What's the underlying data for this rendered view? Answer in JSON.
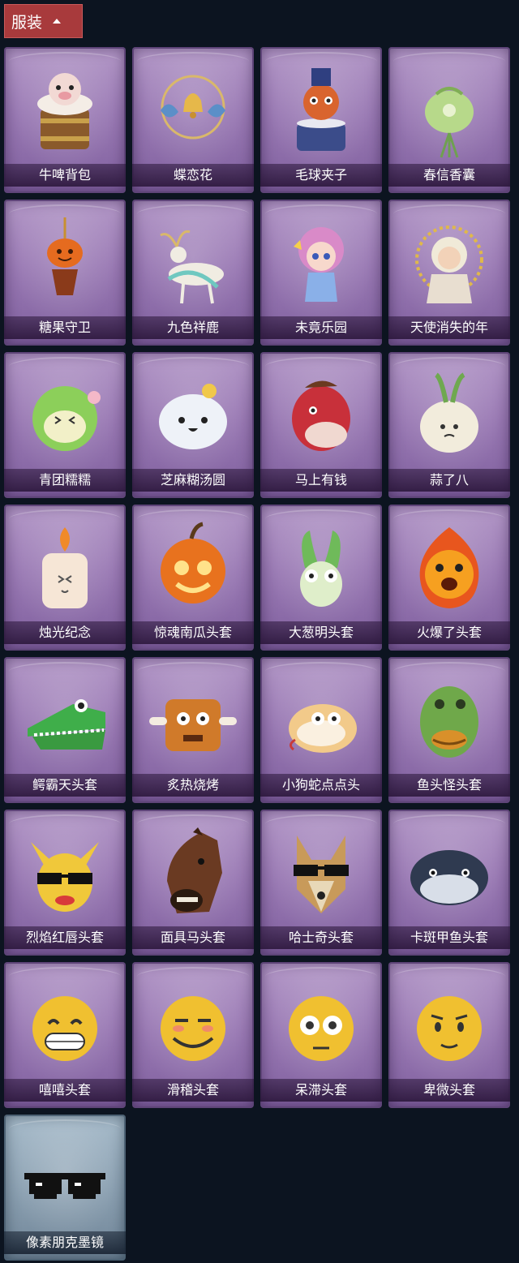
{
  "header": {
    "label": "服装"
  },
  "items": [
    {
      "name": "牛啤背包",
      "icon": "cow-beer-backpack-icon",
      "variant": "purple"
    },
    {
      "name": "蝶恋花",
      "icon": "butterfly-bell-icon",
      "variant": "purple"
    },
    {
      "name": "毛球夹子",
      "icon": "red-panda-drum-icon",
      "variant": "purple"
    },
    {
      "name": "春信香囊",
      "icon": "green-sachet-icon",
      "variant": "purple"
    },
    {
      "name": "糖果守卫",
      "icon": "pumpkin-lantern-icon",
      "variant": "purple"
    },
    {
      "name": "九色祥鹿",
      "icon": "deer-ornament-icon",
      "variant": "purple"
    },
    {
      "name": "未竟乐园",
      "icon": "pink-doll-icon",
      "variant": "purple"
    },
    {
      "name": "天使消失的年",
      "icon": "angel-doll-icon",
      "variant": "purple"
    },
    {
      "name": "青团糯糯",
      "icon": "green-rice-ball-icon",
      "variant": "purple"
    },
    {
      "name": "芝麻糊汤圆",
      "icon": "white-dumpling-icon",
      "variant": "purple"
    },
    {
      "name": "马上有钱",
      "icon": "red-horse-icon",
      "variant": "purple"
    },
    {
      "name": "蒜了八",
      "icon": "garlic-icon",
      "variant": "purple"
    },
    {
      "name": "烛光纪念",
      "icon": "candle-icon",
      "variant": "purple"
    },
    {
      "name": "惊魂南瓜头套",
      "icon": "pumpkin-head-icon",
      "variant": "purple"
    },
    {
      "name": "大葱明头套",
      "icon": "scallion-head-icon",
      "variant": "purple"
    },
    {
      "name": "火爆了头套",
      "icon": "fire-head-icon",
      "variant": "purple"
    },
    {
      "name": "鳄霸天头套",
      "icon": "crocodile-head-icon",
      "variant": "purple"
    },
    {
      "name": "炙热烧烤",
      "icon": "bbq-head-icon",
      "variant": "purple"
    },
    {
      "name": "小狗蛇点点头",
      "icon": "snake-dog-head-icon",
      "variant": "purple"
    },
    {
      "name": "鱼头怪头套",
      "icon": "fish-monster-head-icon",
      "variant": "purple"
    },
    {
      "name": "烈焰红唇头套",
      "icon": "yellow-mouse-head-icon",
      "variant": "purple"
    },
    {
      "name": "面具马头套",
      "icon": "horse-mask-icon",
      "variant": "purple"
    },
    {
      "name": "哈士奇头套",
      "icon": "husky-head-icon",
      "variant": "purple"
    },
    {
      "name": "卡斑甲鱼头套",
      "icon": "catfish-head-icon",
      "variant": "purple"
    },
    {
      "name": "嘻嘻头套",
      "icon": "grin-emoji-head-icon",
      "variant": "purple"
    },
    {
      "name": "滑稽头套",
      "icon": "smirk-emoji-head-icon",
      "variant": "purple"
    },
    {
      "name": "呆滞头套",
      "icon": "dazed-emoji-head-icon",
      "variant": "purple"
    },
    {
      "name": "卑微头套",
      "icon": "humble-emoji-head-icon",
      "variant": "purple"
    },
    {
      "name": "像素朋克墨镜",
      "icon": "pixel-sunglasses-icon",
      "variant": "blue"
    }
  ]
}
